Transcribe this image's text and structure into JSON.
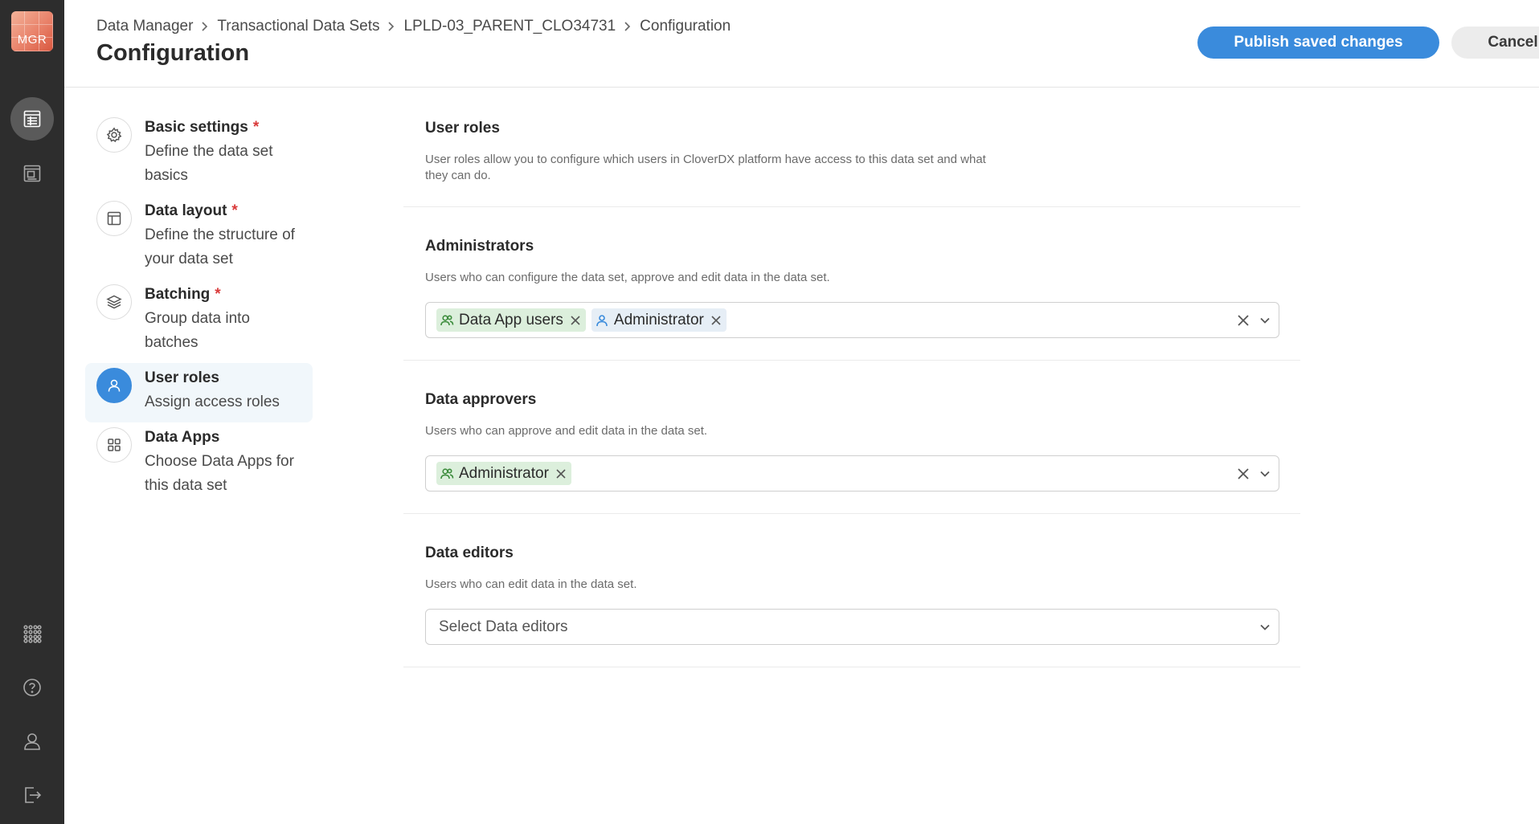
{
  "app": {
    "logo_text": "MGR"
  },
  "rail": {
    "items": [
      "data-sets-icon",
      "data-app-icon",
      "apps-grid-icon",
      "help-icon",
      "user-icon",
      "logout-icon"
    ]
  },
  "breadcrumb": [
    "Data Manager",
    "Transactional Data Sets",
    "LPLD-03_PARENT_CLO34731",
    "Configuration"
  ],
  "page_title": "Configuration",
  "actions": {
    "publish": "Publish saved changes",
    "cancel": "Cancel"
  },
  "steps": [
    {
      "title": "Basic settings",
      "required": "*",
      "desc_line1": "Define the data set",
      "desc_line2": "basics",
      "icon": "gear-icon"
    },
    {
      "title": "Data layout",
      "required": "*",
      "desc_line1": "Define the structure of",
      "desc_line2": "your data set",
      "icon": "layout-icon"
    },
    {
      "title": "Batching",
      "required": "*",
      "desc_line1": "Group data into",
      "desc_line2": "batches",
      "icon": "layers-icon"
    },
    {
      "title": "User roles",
      "desc_line1": "Assign access roles",
      "icon": "user-icon",
      "active": true
    },
    {
      "title": "Data Apps",
      "desc_line1": "Choose Data Apps for",
      "desc_line2": "this data set",
      "icon": "apps-icon"
    }
  ],
  "sections": {
    "intro": {
      "title": "User roles",
      "description": "User roles allow you to configure which users in CloverDX platform have access to this data set and what they can do."
    },
    "administrators": {
      "title": "Administrators",
      "description": "Users who can configure the data set, approve and edit data in the data set.",
      "selected": [
        {
          "label": "Data App users",
          "type": "group"
        },
        {
          "label": "Administrator",
          "type": "user"
        }
      ]
    },
    "approvers": {
      "title": "Data approvers",
      "description": "Users who can approve and edit data in the data set.",
      "selected": [
        {
          "label": "Administrator",
          "type": "group"
        }
      ]
    },
    "editors": {
      "title": "Data editors",
      "description": "Users who can edit data in the data set.",
      "placeholder": "Select Data editors"
    }
  },
  "colors": {
    "primary": "#3a8bdc",
    "rail": "#2d2d2d",
    "required": "#d93a3a",
    "group_tag": "#dcefdc",
    "user_tag": "#e6eef6"
  }
}
